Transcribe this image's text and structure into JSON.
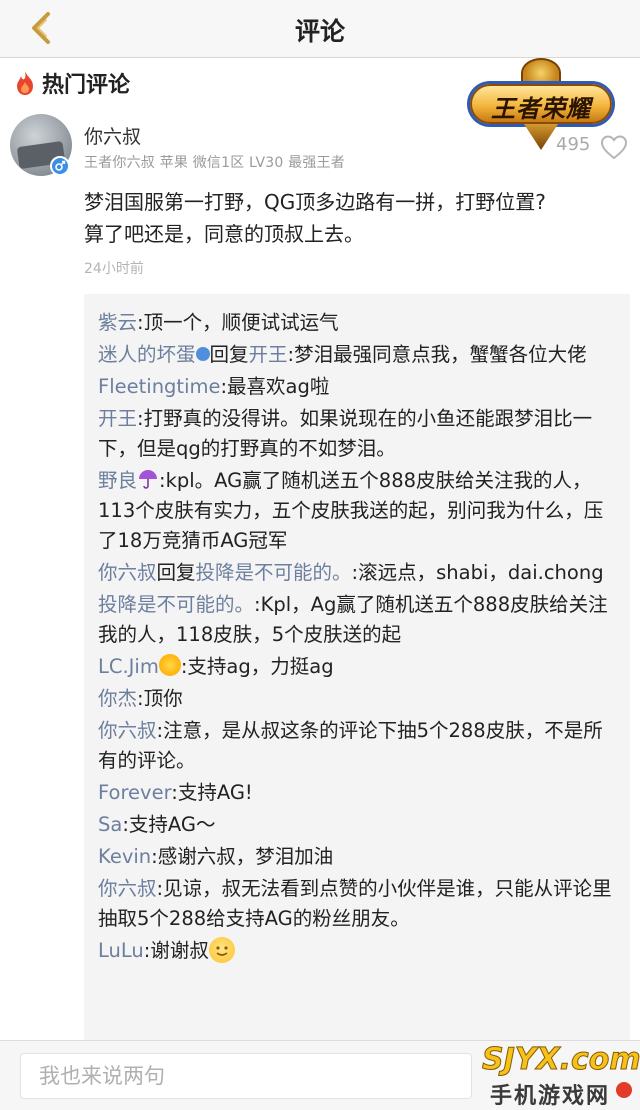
{
  "header": {
    "title": "评论"
  },
  "section": {
    "hot_label": "热门评论"
  },
  "comment": {
    "username": "你六叔",
    "meta": "王者你六叔 苹果 微信1区 LV30 最强王者",
    "text_line1": "梦泪国服第一打野，QG顶多边路有一拼，打野位置?",
    "text_line2": "算了吧还是，同意的顶叔上去。",
    "time": "24小时前",
    "likes": "495"
  },
  "logo": {
    "text": "王者荣耀"
  },
  "replies": [
    {
      "name": "紫云",
      "text": ":顶一个，顺便试试运气"
    },
    {
      "name": "迷人的坏蛋",
      "emoji": "flower",
      "reply_word": "回复",
      "reply_to": "开王",
      "text": ":梦泪最强同意点我，蟹蟹各位大佬"
    },
    {
      "name": "Fleetingtime",
      "text": ":最喜欢ag啦"
    },
    {
      "name": "开王",
      "text": ":打野真的没得讲。如果说现在的小鱼还能跟梦泪比一下，但是qg的打野真的不如梦泪。"
    },
    {
      "name": "野良",
      "emoji": "umbrella",
      "text": ":kpl。AG赢了随机送五个888皮肤给关注我的人，113个皮肤有实力，五个皮肤我送的起，别问我为什么，压了18万竞猜币AG冠军",
      "tail_emoji": "purple-heart"
    },
    {
      "name": "你六叔",
      "reply_word": "回复",
      "reply_to": "投降是不可能的。",
      "text": ":滚远点，shabi，dai.chong"
    },
    {
      "name": "投降是不可能的。",
      "text": ":Kpl，Ag赢了随机送五个888皮肤给关注我的人，118皮肤，5个皮肤送的起"
    },
    {
      "name": "LC.Jim",
      "emoji": "sun",
      "text": ":支持ag，力挺ag"
    },
    {
      "name": "你杰",
      "text": ":顶你"
    },
    {
      "name": "你六叔",
      "text": ":注意，是从叔这条的评论下抽5个288皮肤，不是所有的评论。"
    },
    {
      "name": "Forever",
      "text": ":支持AG!"
    },
    {
      "name": "Sa",
      "text": ":支持AG～"
    },
    {
      "name": "Kevin",
      "text": ":感谢六叔，梦泪加油"
    },
    {
      "name": "你六叔",
      "text": ":见谅，叔无法看到点赞的小伙伴是谁，只能从评论里抽取5个288给支持AG的粉丝朋友。"
    },
    {
      "name": "LuLu",
      "text": ":谢谢叔",
      "tail_emoji": "smile"
    }
  ],
  "input": {
    "placeholder": "我也来说两句"
  },
  "watermark": {
    "top": "SJYX.com",
    "sub": "手机游戏网"
  }
}
